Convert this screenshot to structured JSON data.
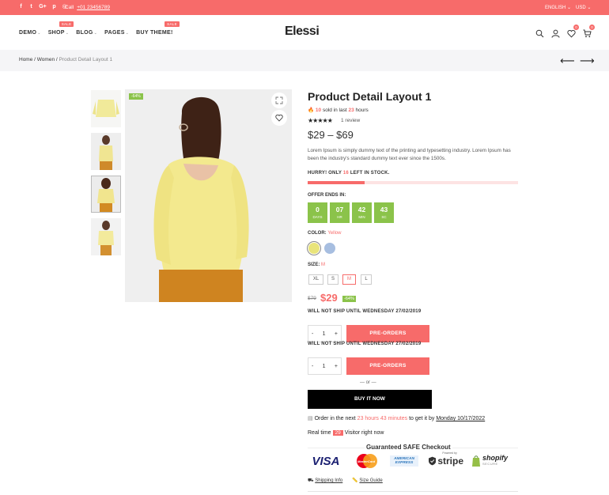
{
  "topbar": {
    "call_label": "Call",
    "phone": "+01 23456789",
    "language": "ENGLISH",
    "currency": "USD",
    "social_icons": [
      "facebook-icon",
      "twitter-icon",
      "google-plus-icon",
      "pinterest-icon",
      "instagram-icon"
    ]
  },
  "header": {
    "logo_text": "Elessi",
    "nav": [
      {
        "label": "DEMO"
      },
      {
        "label": "SHOP",
        "badge": "SALE"
      },
      {
        "label": "BLOG"
      },
      {
        "label": "PAGES"
      },
      {
        "label": "BUY THEME!",
        "badge": "SALE"
      }
    ],
    "wishlist_count": "0",
    "cart_count": "0"
  },
  "breadcrumb": {
    "home": "Home",
    "sep": "/",
    "category": "Women",
    "current": "Product Detail Layout 1"
  },
  "gallery": {
    "sale_tag": "-64%"
  },
  "product": {
    "title": "Product Detail Layout 1",
    "sold_count": "10",
    "sold_text_mid": "sold in last",
    "sold_hours": "23",
    "sold_text_end": "hours",
    "rating": 5,
    "reviews": "1 review",
    "price_range": "$29 – $69",
    "description": "Lorem Ipsum is simply dummy text of the printing and typesetting industry. Lorem Ipsum has been the industry's standard dummy text ever since the 1500s.",
    "hurry_prefix": "HURRY! ONLY",
    "stock_count": "16",
    "hurry_suffix": "LEFT IN STOCK.",
    "stock_fraction": 0.27,
    "offer_label": "OFFER ENDS IN:",
    "countdown": [
      {
        "value": "0",
        "unit": "DAYS"
      },
      {
        "value": "07",
        "unit": "HR"
      },
      {
        "value": "42",
        "unit": "MIN"
      },
      {
        "value": "43",
        "unit": "SC"
      }
    ],
    "color_label": "COLOR:",
    "color_selected": "Yellow",
    "colors": [
      "#e9e47a",
      "#a7bee0"
    ],
    "size_label": "SIZE:",
    "size_selected": "M",
    "sizes": [
      "XL",
      "S",
      "M",
      "L"
    ],
    "old_price": "$79",
    "new_price": "$29",
    "discount": "-64%",
    "ship_note": "WILL NOT SHIP UNTIL WEDNESDAY 27/02/2019",
    "qty": "1",
    "qty_minus": "-",
    "qty_plus": "+",
    "preorder_label": "PRE-ORDERS",
    "or_label": "— or —",
    "buy_now": "BUY IT NOW",
    "order_prefix": "Order in the next",
    "order_time": "23 hours 43 minutes",
    "order_mid": "to get it by",
    "order_date": "Monday 10/17/2022",
    "realtime_prefix": "Real time",
    "realtime_count": "29",
    "realtime_suffix": "Visitor right now",
    "safe_checkout": "Guaranteed SAFE Checkout",
    "payments": [
      "VISA",
      "MasterCard",
      "AMERICAN EXPRESS",
      "stripe",
      "shopify"
    ],
    "stripe_small": "Powered by",
    "shopify_small": "SECURE",
    "shipping_info": "Shipping Info",
    "size_guide": "Size Guide"
  },
  "colors": {
    "accent": "#f76b6a",
    "green": "#8bc34a"
  }
}
